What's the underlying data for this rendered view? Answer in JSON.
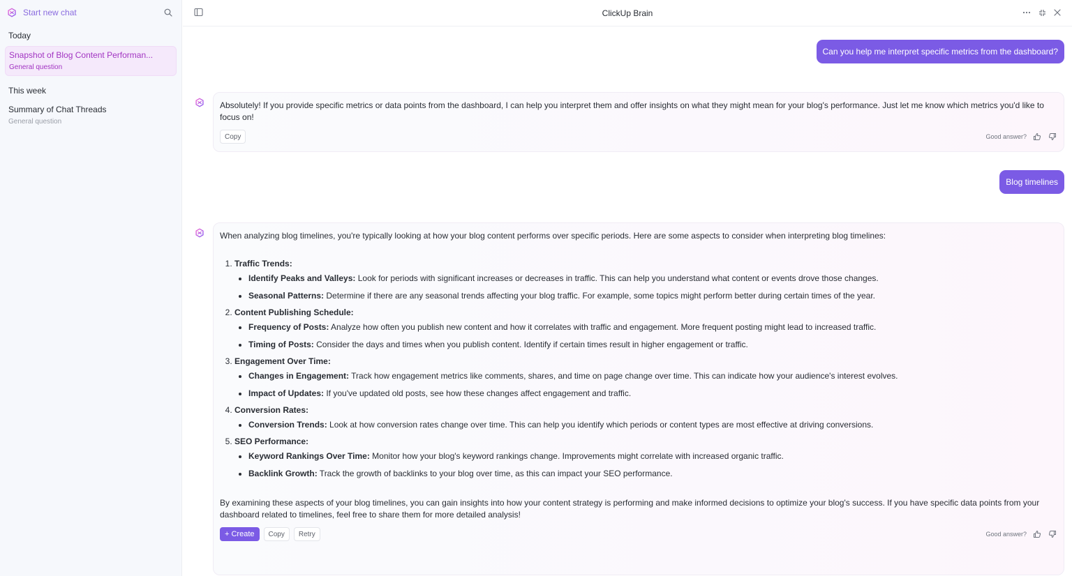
{
  "sidebar": {
    "new_chat_label": "Start new chat",
    "sections": [
      {
        "title": "Today",
        "items": [
          {
            "title": "Snapshot of Blog Content Performan...",
            "sub": "General question",
            "active": true
          }
        ]
      },
      {
        "title": "This week",
        "items": [
          {
            "title": "Summary of Chat Threads",
            "sub": "General question",
            "active": false
          }
        ]
      }
    ]
  },
  "header": {
    "title": "ClickUp Brain"
  },
  "conversation": {
    "user_msg_1": "Can you help me interpret specific metrics from the dashboard?",
    "ai_msg_1": {
      "text": "Absolutely! If you provide specific metrics or data points from the dashboard, I can help you interpret them and offer insights on what they might mean for your blog's performance. Just let me know which metrics you'd like to focus on!",
      "copy_label": "Copy",
      "feedback_label": "Good answer?"
    },
    "user_msg_2": "Blog timelines",
    "ai_msg_2": {
      "intro": "When analyzing blog timelines, you're typically looking at how your blog content performs over specific periods. Here are some aspects to consider when interpreting blog timelines:",
      "sections": [
        {
          "title": "Traffic Trends:",
          "points": [
            {
              "term": "Identify Peaks and Valleys:",
              "desc": " Look for periods with significant increases or decreases in traffic. This can help you understand what content or events drove those changes."
            },
            {
              "term": "Seasonal Patterns:",
              "desc": " Determine if there are any seasonal trends affecting your blog traffic. For example, some topics might perform better during certain times of the year."
            }
          ]
        },
        {
          "title": "Content Publishing Schedule:",
          "points": [
            {
              "term": "Frequency of Posts:",
              "desc": " Analyze how often you publish new content and how it correlates with traffic and engagement. More frequent posting might lead to increased traffic."
            },
            {
              "term": "Timing of Posts:",
              "desc": " Consider the days and times when you publish content. Identify if certain times result in higher engagement or traffic."
            }
          ]
        },
        {
          "title": "Engagement Over Time:",
          "points": [
            {
              "term": "Changes in Engagement:",
              "desc": " Track how engagement metrics like comments, shares, and time on page change over time. This can indicate how your audience's interest evolves."
            },
            {
              "term": "Impact of Updates:",
              "desc": " If you've updated old posts, see how these changes affect engagement and traffic."
            }
          ]
        },
        {
          "title": "Conversion Rates:",
          "points": [
            {
              "term": "Conversion Trends:",
              "desc": " Look at how conversion rates change over time. This can help you identify which periods or content types are most effective at driving conversions."
            }
          ]
        },
        {
          "title": "SEO Performance:",
          "points": [
            {
              "term": "Keyword Rankings Over Time:",
              "desc": " Monitor how your blog's keyword rankings change. Improvements might correlate with increased organic traffic."
            },
            {
              "term": "Backlink Growth:",
              "desc": " Track the growth of backlinks to your blog over time, as this can impact your SEO performance."
            }
          ]
        }
      ],
      "outro": "By examining these aspects of your blog timelines, you can gain insights into how your content strategy is performing and make informed decisions to optimize your blog's success. If you have specific data points from your dashboard related to timelines, feel free to share them for more detailed analysis!",
      "create_label": "+ Create",
      "copy_label": "Copy",
      "retry_label": "Retry",
      "feedback_label": "Good answer?"
    }
  },
  "colors": {
    "accent": "#7b5be5",
    "active_item": "#a234c2",
    "sidebar_bg": "#f6f8fc"
  }
}
